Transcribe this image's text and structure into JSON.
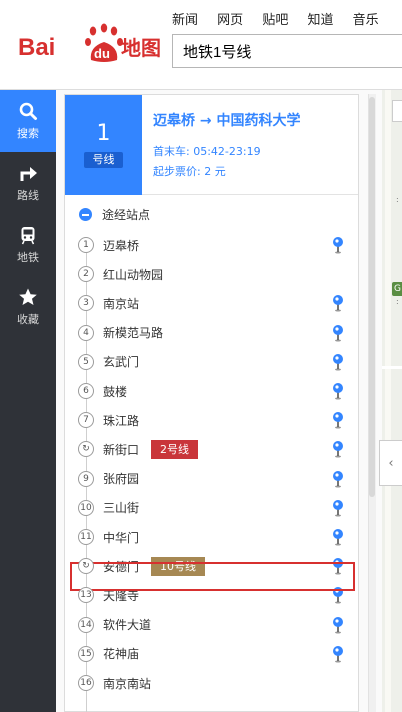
{
  "header": {
    "nav": [
      "新闻",
      "网页",
      "贴吧",
      "知道",
      "音乐"
    ],
    "logo": {
      "left": "Bai",
      "badge": "du",
      "right": "地图"
    },
    "search_value": "地铁1号线"
  },
  "sidebar": [
    {
      "label": "搜索",
      "icon": "search-icon",
      "active": true
    },
    {
      "label": "路线",
      "icon": "route-icon",
      "active": false
    },
    {
      "label": "地铁",
      "icon": "subway-icon",
      "active": false
    },
    {
      "label": "收藏",
      "icon": "star-icon",
      "active": false
    }
  ],
  "line": {
    "number": "1",
    "unit": "号线",
    "route": "迈皋桥 → 中国药科大学",
    "hours_label": "首末车:",
    "hours": "05:42-23:19",
    "fare_label": "起步票价:",
    "fare": "2 元",
    "color": "#3385ff"
  },
  "stations_header": "途经站点",
  "stations": [
    {
      "num": "1",
      "name": "迈皋桥",
      "pin": true
    },
    {
      "num": "2",
      "name": "红山动物园",
      "pin": false
    },
    {
      "num": "3",
      "name": "南京站",
      "pin": true
    },
    {
      "num": "4",
      "name": "新模范马路",
      "pin": true
    },
    {
      "num": "5",
      "name": "玄武门",
      "pin": true
    },
    {
      "num": "6",
      "name": "鼓楼",
      "pin": true
    },
    {
      "num": "7",
      "name": "珠江路",
      "pin": true
    },
    {
      "num": "↻",
      "name": "新街口",
      "pin": true,
      "transfer": "2号线",
      "transfer_color": "#c9353a"
    },
    {
      "num": "9",
      "name": "张府园",
      "pin": true
    },
    {
      "num": "10",
      "name": "三山街",
      "pin": true
    },
    {
      "num": "11",
      "name": "中华门",
      "pin": true
    },
    {
      "num": "↻",
      "name": "安德门",
      "pin": true,
      "transfer": "10号线",
      "transfer_color": "#a68853",
      "highlighted": true
    },
    {
      "num": "13",
      "name": "天隆寺",
      "pin": true
    },
    {
      "num": "14",
      "name": "软件大道",
      "pin": true
    },
    {
      "num": "15",
      "name": "花神庙",
      "pin": true
    },
    {
      "num": "16",
      "name": "南京南站",
      "pin": false
    }
  ],
  "map_badge": "G"
}
